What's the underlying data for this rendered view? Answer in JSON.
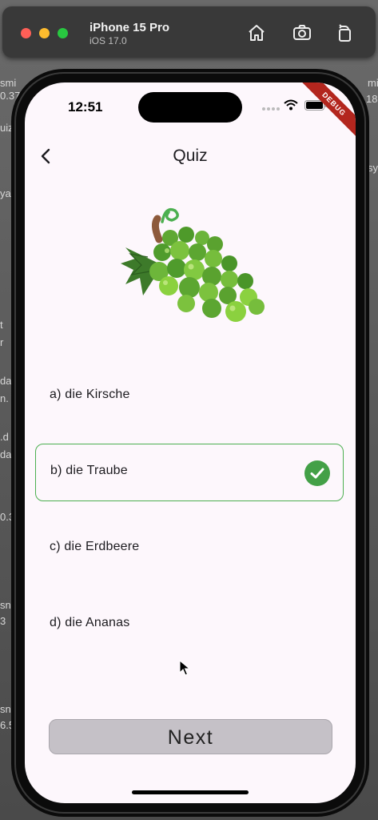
{
  "simulator": {
    "device": "iPhone 15 Pro",
    "os": "iOS 17.0",
    "icons": [
      "home-icon",
      "screenshot-icon",
      "rotate-icon"
    ]
  },
  "status_bar": {
    "time": "12:51",
    "debug_banner": "DEBUG"
  },
  "app_bar": {
    "title": "Quiz",
    "back_icon": "chevron-left-icon"
  },
  "question": {
    "image": "grapes-illustration"
  },
  "options": [
    {
      "label": "a) die Kirsche",
      "selected": false
    },
    {
      "label": "b) die Traube",
      "selected": true,
      "correct": true
    },
    {
      "label": "c) die Erdbeere",
      "selected": false
    },
    {
      "label": "d) die Ananas",
      "selected": false
    }
  ],
  "next_button": {
    "label": "Next"
  },
  "colors": {
    "accent_green": "#4caf50",
    "check_green": "#43a047",
    "screen_bg": "#fdf7fc",
    "button_gray": "#c5c1c7"
  },
  "background_text": [
    "smi",
    "0.37",
    "uiz",
    "ya",
    "t",
    "r",
    "da",
    "n.",
    ".d",
    "da",
    "0.3",
    "sn",
    "3",
    "sn",
    "6.5",
    "mi",
    "18",
    "sy"
  ]
}
